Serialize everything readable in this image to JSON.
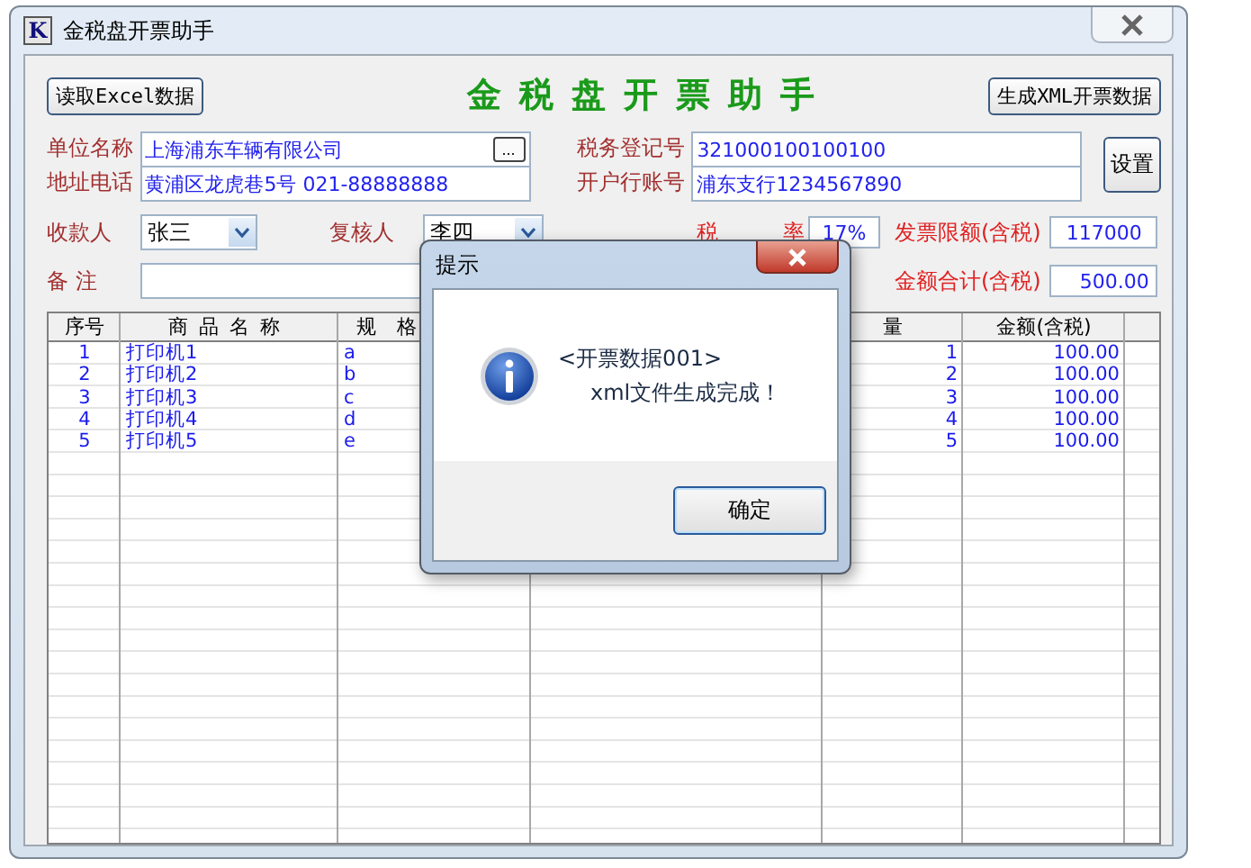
{
  "window": {
    "app_icon": "K",
    "title": "金税盘开票助手"
  },
  "toolbar": {
    "read_button": "读取Excel数据",
    "heading": "金税盘开票助手",
    "generate_button": "生成XML开票数据"
  },
  "company": {
    "name_label": "单位名称",
    "name": "上海浦东车辆有限公司",
    "browse_button": "...",
    "address_label": "地址电话",
    "address": "黄浦区龙虎巷5号 021-88888888",
    "tax_id_label": "税务登记号",
    "tax_id": "321000100100100",
    "bank_label": "开户行账号",
    "bank": "浦东支行1234567890",
    "settings_button": "设置"
  },
  "people": {
    "payee_label": "收款人",
    "payee": "张三",
    "reviewer_label": "复核人",
    "reviewer": "李四",
    "tax_rate_label": "税 率",
    "tax_rate": "17%",
    "limit_label": "发票限额(含税)",
    "limit": "117000"
  },
  "remark": {
    "label": "备 注",
    "total_label": "金额合计(含税)",
    "total": "500.00"
  },
  "table": {
    "columns": [
      "序号",
      "商品名称",
      "规 格",
      "量",
      "金额(含税)"
    ],
    "rows": [
      [
        "1",
        "打印机1",
        "a",
        "1",
        "100.00"
      ],
      [
        "2",
        "打印机2",
        "b",
        "2",
        "100.00"
      ],
      [
        "3",
        "打印机3",
        "c",
        "3",
        "100.00"
      ],
      [
        "4",
        "打印机4",
        "d",
        "4",
        "100.00"
      ],
      [
        "5",
        "打印机5",
        "e",
        "5",
        "100.00"
      ]
    ]
  },
  "dialog": {
    "title": "提示",
    "message_lines": [
      "<开票数据001>",
      "xml文件生成完成！"
    ],
    "ok_button": "确定"
  }
}
